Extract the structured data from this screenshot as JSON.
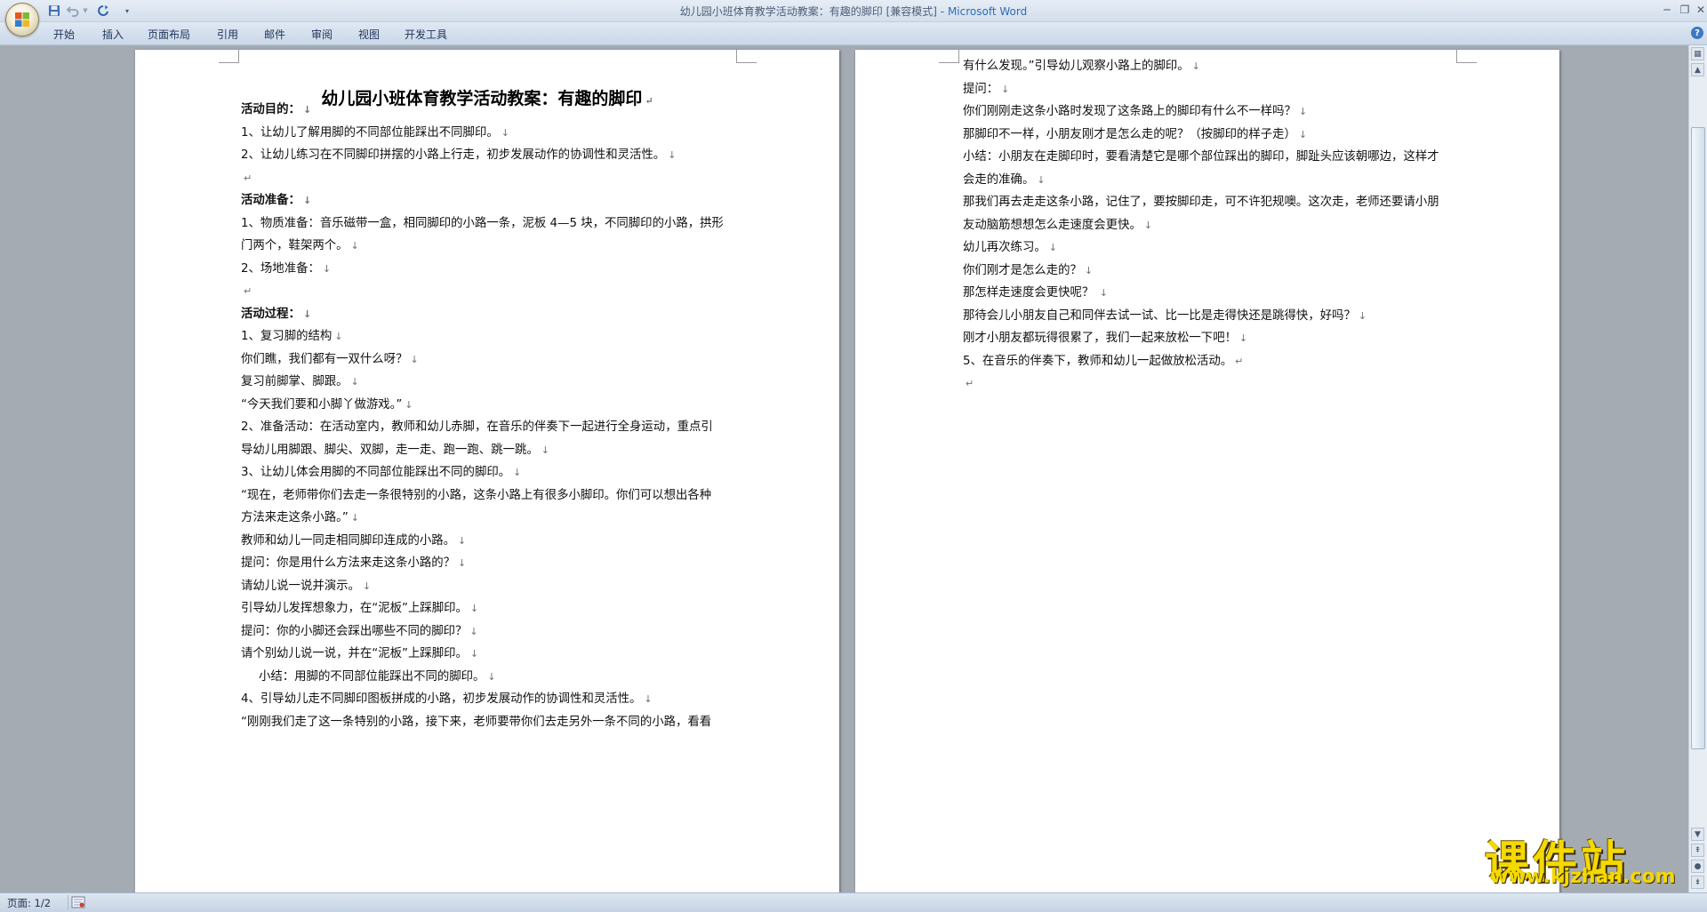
{
  "window": {
    "title_doc": "幼儿园小班体育教学活动教案：有趣的脚印 [兼容模式]",
    "title_sep": " - ",
    "title_app": "Microsoft Word"
  },
  "ribbon": {
    "tabs": [
      "开始",
      "插入",
      "页面布局",
      "引用",
      "邮件",
      "审阅",
      "视图",
      "开发工具"
    ]
  },
  "document": {
    "title": "幼儿园小班体育教学活动教案：有趣的脚印",
    "page1_lines": [
      {
        "text": "活动目的：",
        "bold": true,
        "mark": "↓"
      },
      {
        "text": "1、让幼儿了解用脚的不同部位能踩出不同脚印。",
        "mark": "↓"
      },
      {
        "text": "2、让幼儿练习在不同脚印拼摆的小路上行走，初步发展动作的协调性和灵活性。",
        "mark": "↓"
      },
      {
        "text": "",
        "mark": "↵"
      },
      {
        "text": "活动准备：",
        "bold": true,
        "mark": "↓"
      },
      {
        "text": "1、物质准备：音乐磁带一盒，相同脚印的小路一条，泥板 4—5 块，不同脚印的小路，拱形",
        "mark": ""
      },
      {
        "text": "门两个，鞋架两个。",
        "mark": "↓"
      },
      {
        "text": "2、场地准备：",
        "mark": "↓"
      },
      {
        "text": "",
        "mark": "↵"
      },
      {
        "text": "活动过程：",
        "bold": true,
        "mark": "↓"
      },
      {
        "text": "1、复习脚的结构",
        "mark": "↓"
      },
      {
        "text": "你们瞧，我们都有一双什么呀？",
        "mark": "↓"
      },
      {
        "text": "复习前脚掌、脚跟。",
        "mark": "↓"
      },
      {
        "text": "“今天我们要和小脚丫做游戏。”",
        "mark": "↓"
      },
      {
        "text": "2、准备活动：在活动室内，教师和幼儿赤脚，在音乐的伴奏下一起进行全身运动，重点引",
        "mark": ""
      },
      {
        "text": "导幼儿用脚跟、脚尖、双脚，走一走、跑一跑、跳一跳。",
        "mark": "↓"
      },
      {
        "text": "3、让幼儿体会用脚的不同部位能踩出不同的脚印。",
        "mark": "↓"
      },
      {
        "text": "“现在，老师带你们去走一条很特别的小路，这条小路上有很多小脚印。你们可以想出各种",
        "mark": ""
      },
      {
        "text": "方法来走这条小路。”",
        "mark": "↓"
      },
      {
        "text": "教师和幼儿一同走相同脚印连成的小路。",
        "mark": "↓"
      },
      {
        "text": "提问：你是用什么方法来走这条小路的？",
        "mark": "↓"
      },
      {
        "text": "请幼儿说一说并演示。",
        "mark": "↓"
      },
      {
        "text": "引导幼儿发挥想象力，在“泥板”上踩脚印。",
        "mark": "↓"
      },
      {
        "text": "提问：你的小脚还会踩出哪些不同的脚印？",
        "mark": "↓"
      },
      {
        "text": "请个别幼儿说一说，并在“泥板”上踩脚印。",
        "mark": "↓"
      },
      {
        "text": "小结：用脚的不同部位能踩出不同的脚印。",
        "mark": "↓",
        "indent": true
      },
      {
        "text": "4、引导幼儿走不同脚印图板拼成的小路，初步发展动作的协调性和灵活性。",
        "mark": "↓"
      },
      {
        "text": "“刚刚我们走了这一条特别的小路，接下来，老师要带你们去走另外一条不同的小路，看看",
        "mark": ""
      }
    ],
    "page2_lines": [
      {
        "text": "有什么发现。”引导幼儿观察小路上的脚印。",
        "mark": "↓"
      },
      {
        "text": "提问：",
        "mark": "↓"
      },
      {
        "text": "你们刚刚走这条小路时发现了这条路上的脚印有什么不一样吗？",
        "mark": "↓"
      },
      {
        "text": "那脚印不一样，小朋友刚才是怎么走的呢？（按脚印的样子走）",
        "mark": "↓"
      },
      {
        "text": "小结：小朋友在走脚印时，要看清楚它是哪个部位踩出的脚印，脚趾头应该朝哪边，这样才",
        "mark": ""
      },
      {
        "text": "会走的准确。",
        "mark": "↓"
      },
      {
        "text": "那我们再去走走这条小路，记住了，要按脚印走，可不许犯规噢。这次走，老师还要请小朋",
        "mark": ""
      },
      {
        "text": "友动脑筋想想怎么走速度会更快。",
        "mark": "↓"
      },
      {
        "text": "幼儿再次练习。",
        "mark": "↓"
      },
      {
        "text": "你们刚才是怎么走的？",
        "mark": "↓"
      },
      {
        "text": "那怎样走速度会更快呢？",
        "mark": " ↓"
      },
      {
        "text": "那待会儿小朋友自己和同伴去试一试、比一比是走得快还是跳得快，好吗？",
        "mark": "↓"
      },
      {
        "text": "刚才小朋友都玩得很累了，我们一起来放松一下吧！",
        "mark": "↓"
      },
      {
        "text": "5、在音乐的伴奏下，教师和幼儿一起做放松活动。",
        "mark": "↵"
      },
      {
        "text": "",
        "mark": "↵"
      }
    ]
  },
  "statusbar": {
    "page_info": "页面: 1/2"
  },
  "watermark": {
    "logo_text": "课件站",
    "url": "www.kjzhan.com"
  },
  "colors": {
    "title_app": "#2f6db6",
    "watermark": "#f4d900"
  }
}
